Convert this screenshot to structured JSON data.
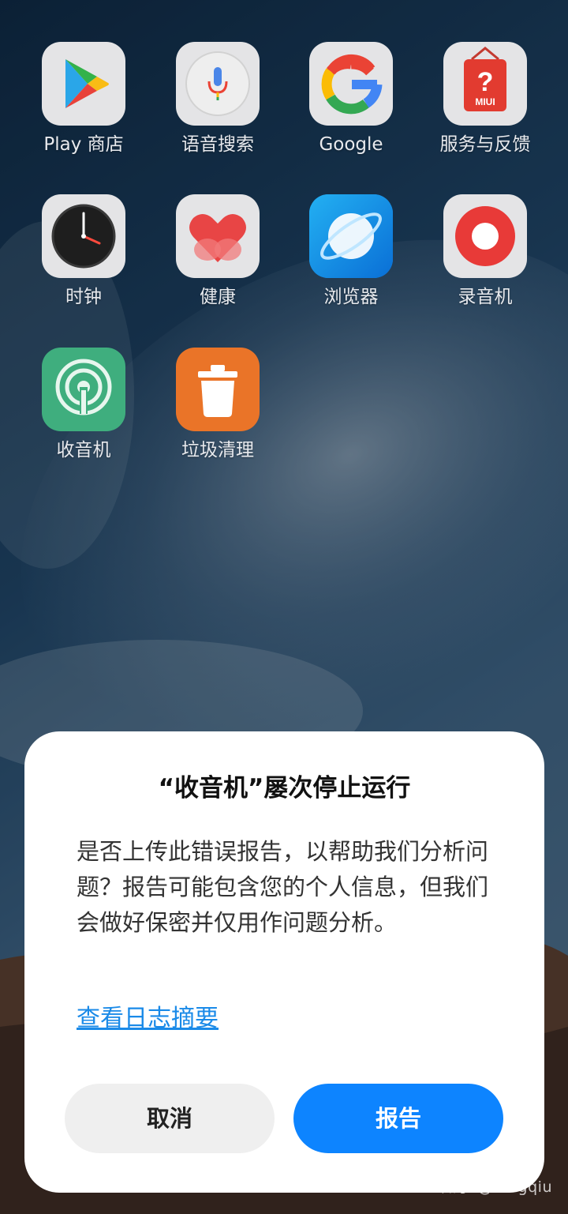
{
  "home": {
    "apps": [
      {
        "label": "Play 商店",
        "icon": "play-store-icon"
      },
      {
        "label": "语音搜索",
        "icon": "voice-search-icon"
      },
      {
        "label": "Google",
        "icon": "google-icon"
      },
      {
        "label": "服务与反馈",
        "icon": "miui-feedback-icon"
      },
      {
        "label": "时钟",
        "icon": "clock-icon"
      },
      {
        "label": "健康",
        "icon": "health-icon"
      },
      {
        "label": "浏览器",
        "icon": "browser-icon"
      },
      {
        "label": "录音机",
        "icon": "recorder-icon"
      },
      {
        "label": "收音机",
        "icon": "radio-icon"
      },
      {
        "label": "垃圾清理",
        "icon": "trash-cleaner-icon"
      }
    ],
    "feedback_icon_text": "MIUI"
  },
  "dialog": {
    "title": "“收音机”屡次停止运行",
    "message": "是否上传此错误报告，以帮助我们分析问题？报告可能包含您的个人信息，但我们会做好保密并仅用作问题分析。",
    "link": "查看日志摘要",
    "cancel_label": "取消",
    "report_label": "报告"
  },
  "watermark": "知乎 @fengqiu",
  "colors": {
    "accent": "#0d84ff",
    "link": "#1a8ae8"
  }
}
